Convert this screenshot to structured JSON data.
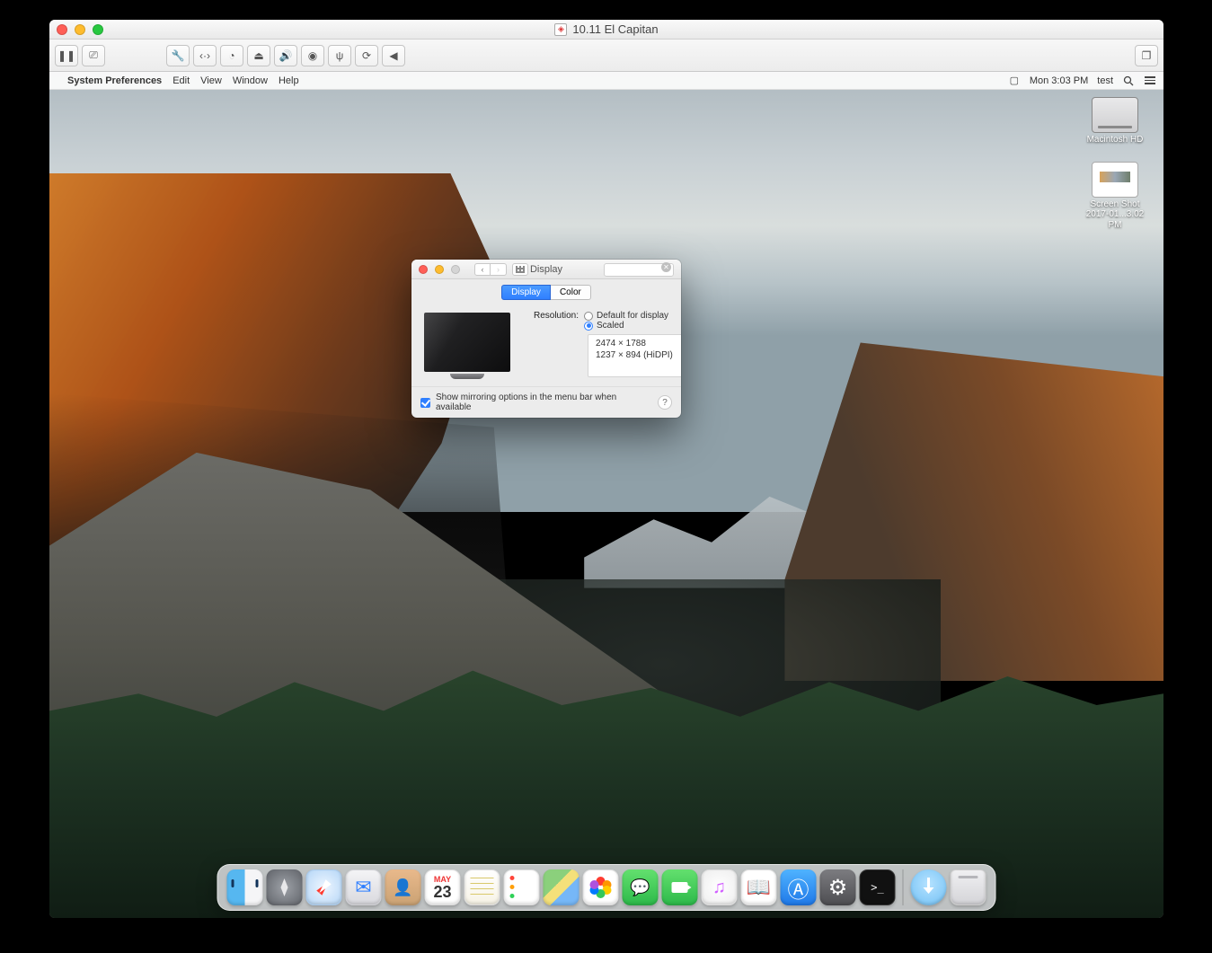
{
  "vm": {
    "title": "10.11 El Capitan",
    "toolbar_icons": [
      "pause-icon",
      "snapshot-icon",
      "wrench-icon",
      "net-icon",
      "disk-icon",
      "lock-icon",
      "sound-icon",
      "camera-icon",
      "usb-icon",
      "sync-icon",
      "back-icon",
      "view-icon"
    ]
  },
  "menubar": {
    "app": "System Preferences",
    "items": [
      "Edit",
      "View",
      "Window",
      "Help"
    ],
    "clock": "Mon 3:03 PM",
    "user": "test"
  },
  "desktop_icons": {
    "hd_label": "Macintosh HD",
    "shot_label_1": "Screen Shot",
    "shot_label_2": "2017-01...3.02 PM"
  },
  "prefs": {
    "title": "Display",
    "tabs": {
      "display": "Display",
      "color": "Color"
    },
    "resolution_label": "Resolution:",
    "opt_default": "Default for display",
    "opt_scaled": "Scaled",
    "resolutions": [
      "2474 × 1788",
      "1237 × 894 (HiDPI)"
    ],
    "mirror_label": "Show mirroring options in the menu bar when available",
    "help": "?"
  },
  "calendar": {
    "month": "MAY",
    "day": "23"
  },
  "dock": {
    "items": [
      "finder",
      "launchpad",
      "safari",
      "mail",
      "contacts",
      "calendar",
      "notes",
      "reminders",
      "maps",
      "photos",
      "messages",
      "facetime",
      "itunes",
      "ibooks",
      "appstore",
      "sysprefs",
      "terminal"
    ],
    "right": [
      "downloads",
      "trash"
    ]
  }
}
